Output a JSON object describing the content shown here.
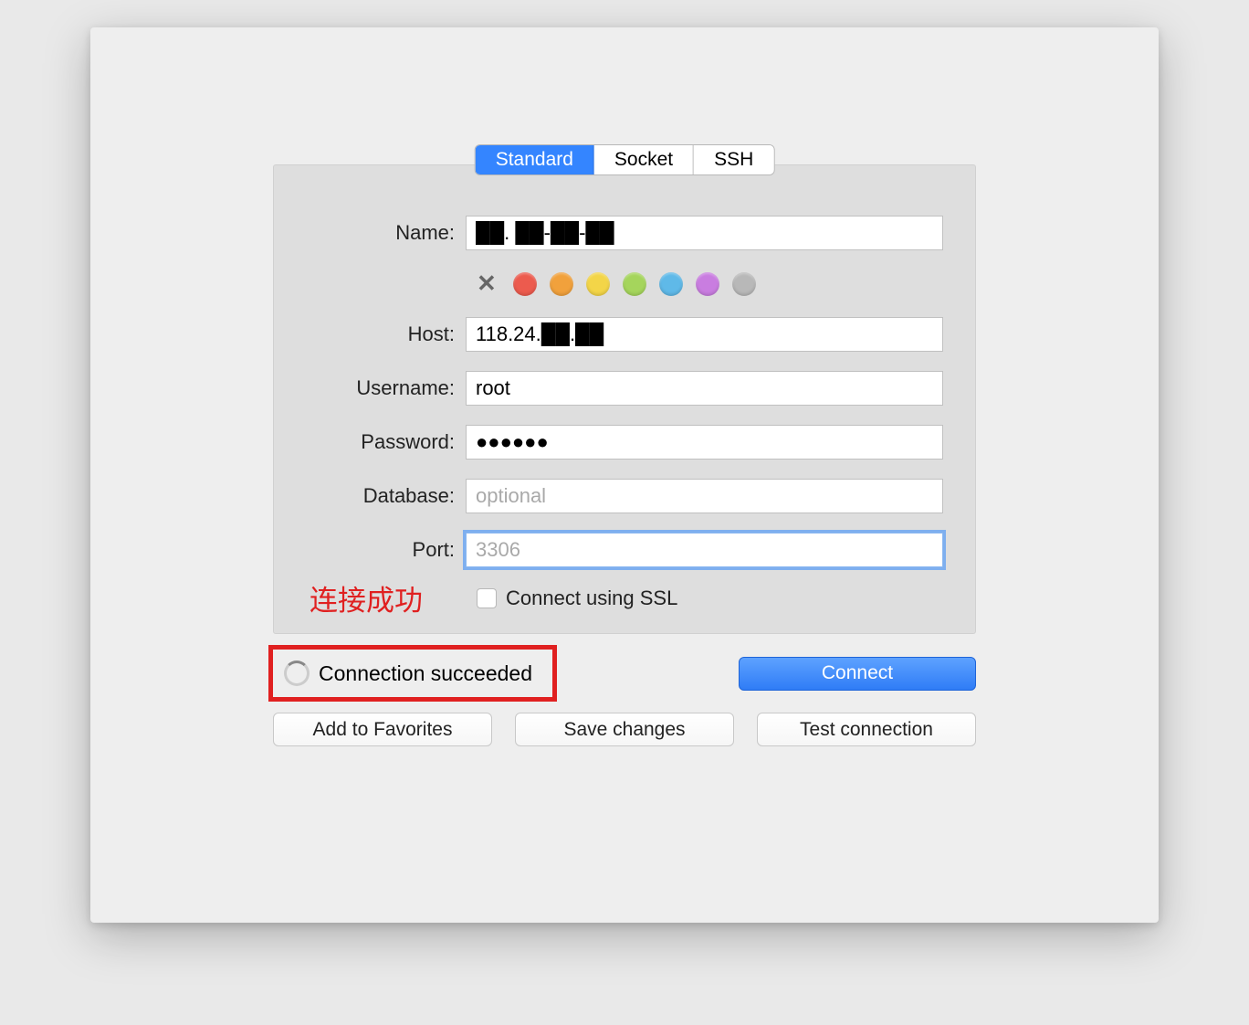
{
  "tabs": {
    "standard": "Standard",
    "socket": "Socket",
    "ssh": "SSH"
  },
  "form": {
    "name_label": "Name:",
    "name_value": "██. ██-██-██",
    "host_label": "Host:",
    "host_value": "118.24.██.██",
    "username_label": "Username:",
    "username_value": "root",
    "password_label": "Password:",
    "password_value": "●●●●●●",
    "database_label": "Database:",
    "database_placeholder": "optional",
    "port_label": "Port:",
    "port_placeholder": "3306",
    "ssl_label": "Connect using SSL"
  },
  "colors": {
    "red": "#ec5b4e",
    "orange": "#f1a13c",
    "yellow": "#f3d548",
    "green": "#a5d55c",
    "blue": "#5fb9e8",
    "purple": "#c97de0",
    "gray": "#b8b8b8"
  },
  "annotation": "连接成功",
  "status": "Connection succeeded",
  "buttons": {
    "connect": "Connect",
    "favorites": "Add to Favorites",
    "save": "Save changes",
    "test": "Test connection"
  }
}
